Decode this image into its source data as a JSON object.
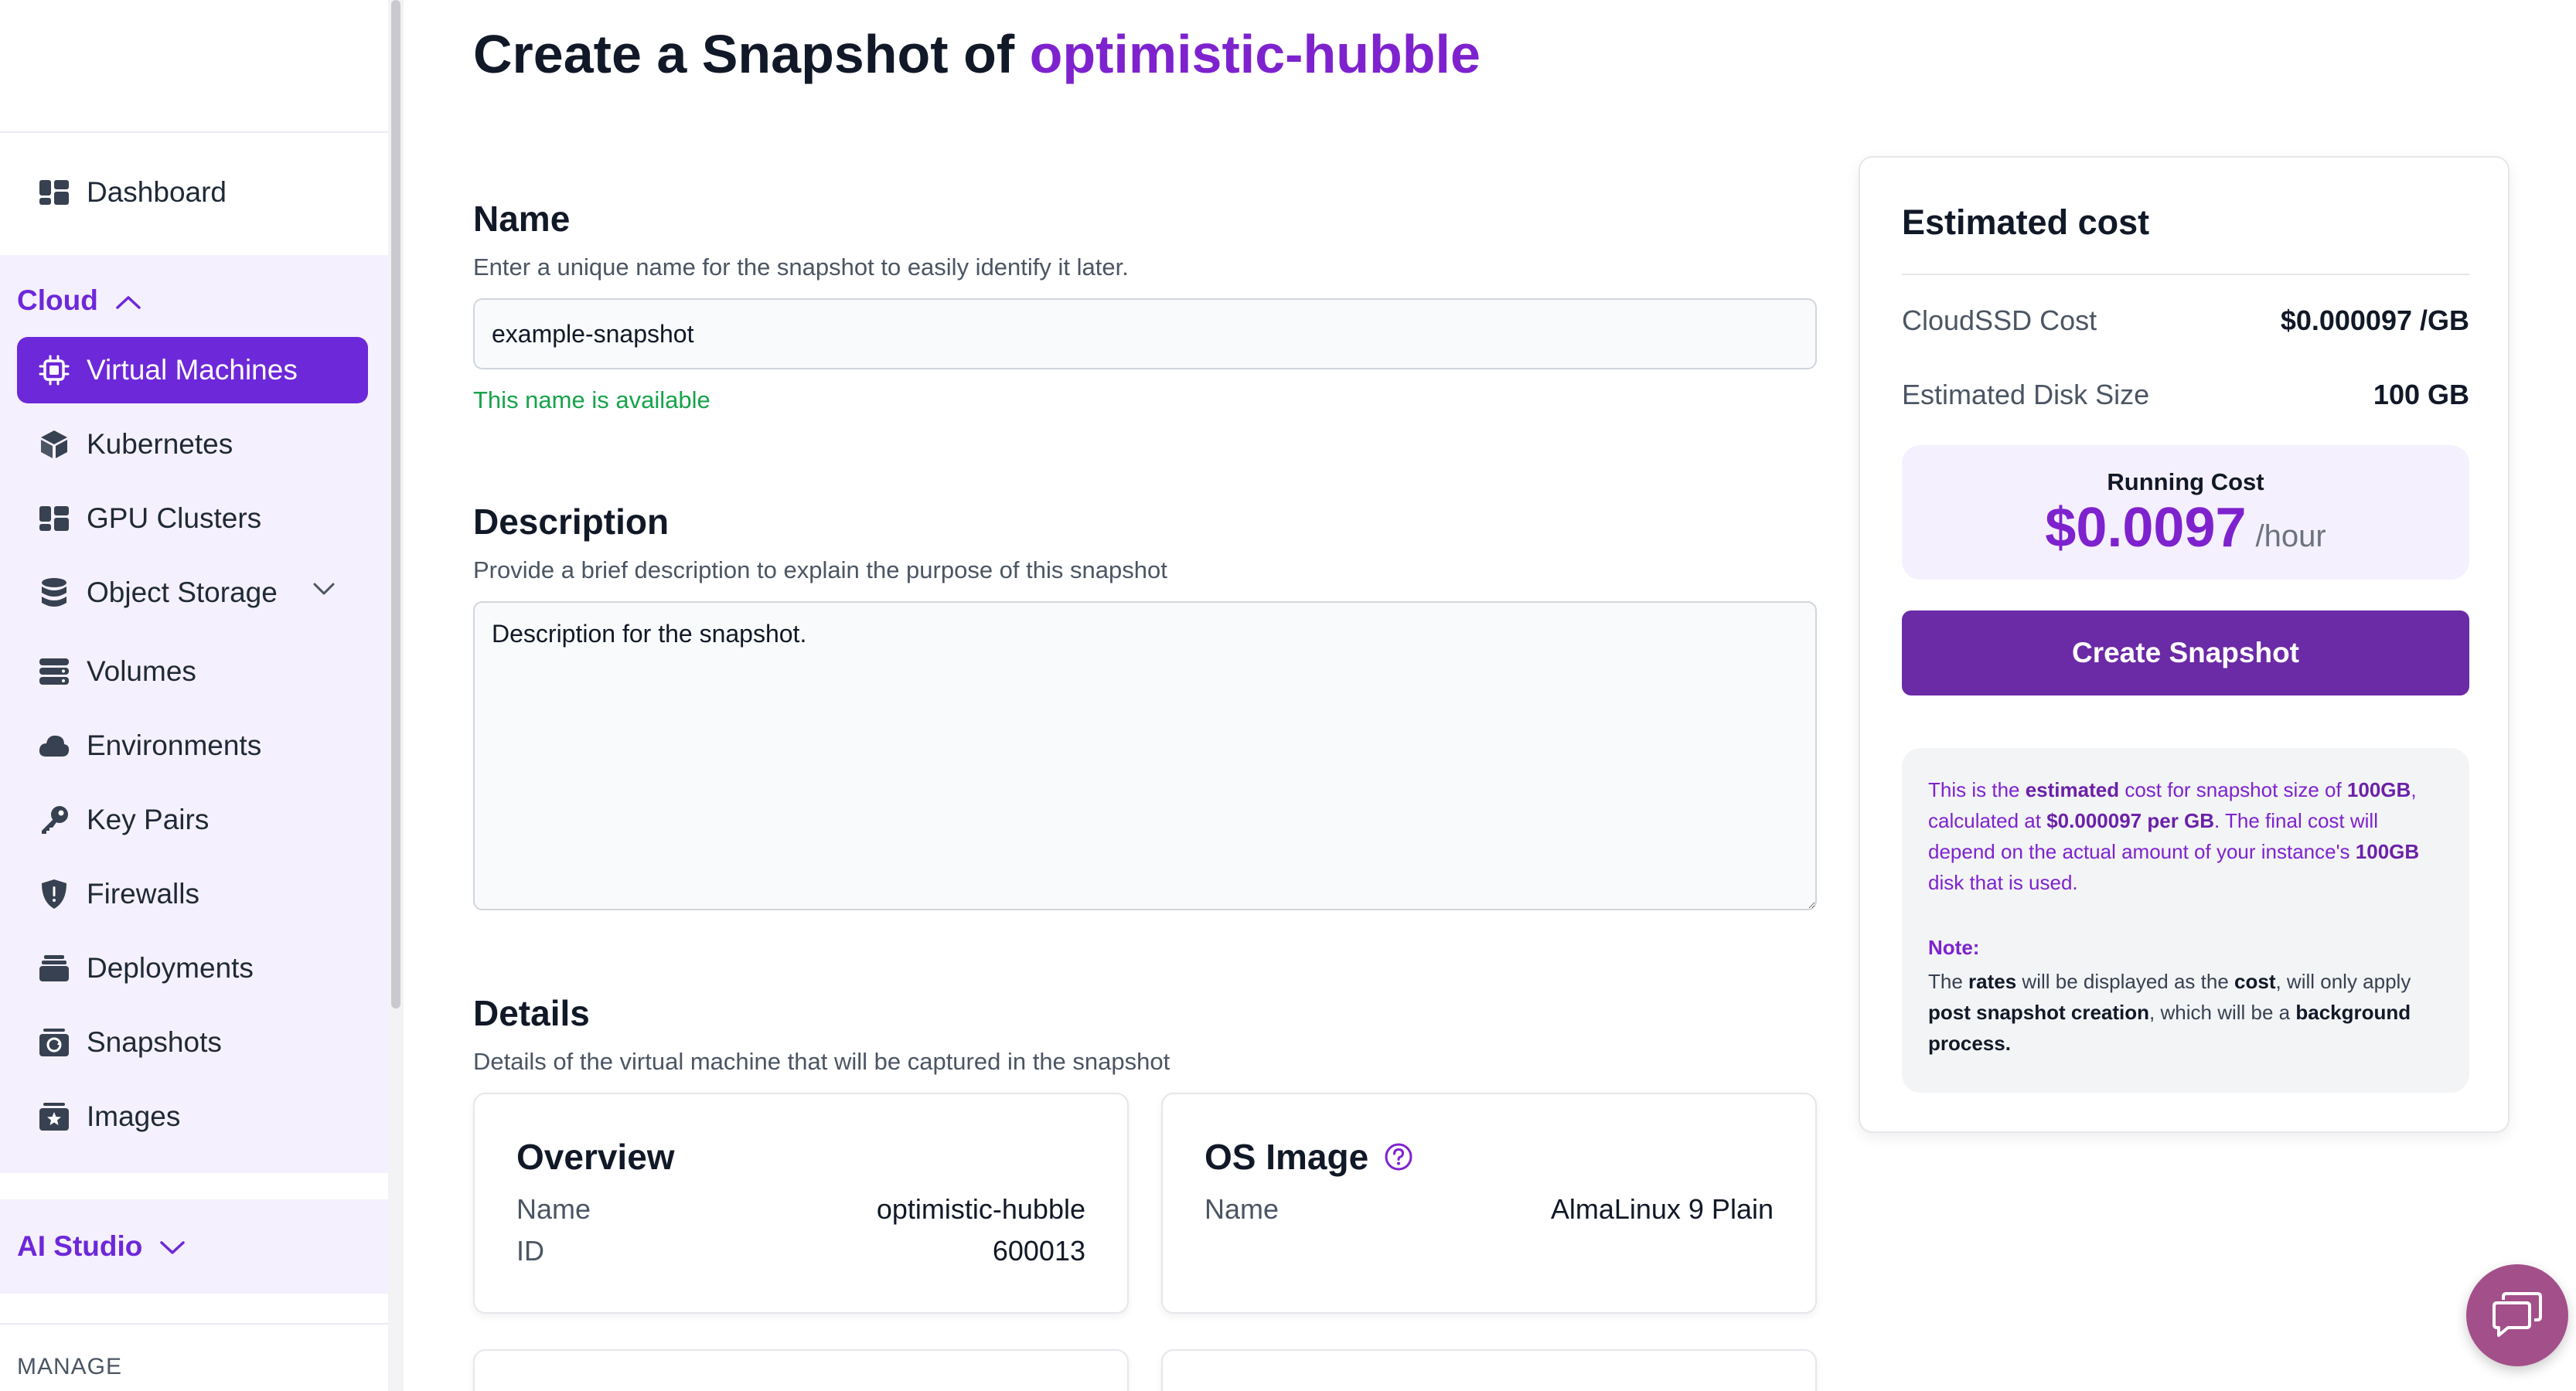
{
  "sidebar": {
    "dashboard": {
      "label": "Dashboard",
      "icon": "dashboard-icon"
    },
    "cloud": {
      "label": "Cloud",
      "items": [
        {
          "label": "Virtual Machines",
          "icon": "cpu-chip-icon",
          "active": true
        },
        {
          "label": "Kubernetes",
          "icon": "cube-icon"
        },
        {
          "label": "GPU Clusters",
          "icon": "grid-icon"
        },
        {
          "label": "Object Storage",
          "icon": "database-icon",
          "has_submenu": true
        },
        {
          "label": "Volumes",
          "icon": "server-stack-icon"
        },
        {
          "label": "Environments",
          "icon": "cloud-icon"
        },
        {
          "label": "Key Pairs",
          "icon": "key-icon"
        },
        {
          "label": "Firewalls",
          "icon": "shield-icon"
        },
        {
          "label": "Deployments",
          "icon": "stack-icon"
        },
        {
          "label": "Snapshots",
          "icon": "camera-icon"
        },
        {
          "label": "Images",
          "icon": "star-image-icon"
        }
      ]
    },
    "ai_studio": {
      "label": "AI Studio"
    },
    "manage_label": "MANAGE"
  },
  "page": {
    "title_prefix": "Create a Snapshot of",
    "title_instance": "optimistic-hubble"
  },
  "form": {
    "name": {
      "title": "Name",
      "subtitle": "Enter a unique name for the snapshot to easily identify it later.",
      "value": "example-snapshot",
      "availability": "This name is available"
    },
    "description": {
      "title": "Description",
      "subtitle": "Provide a brief description to explain the purpose of this snapshot",
      "value": "Description for the snapshot."
    },
    "details": {
      "title": "Details",
      "subtitle": "Details of the virtual machine that will be captured in the snapshot",
      "overview": {
        "title": "Overview",
        "name_label": "Name",
        "name_value": "optimistic-hubble",
        "id_label": "ID",
        "id_value": "600013"
      },
      "os_image": {
        "title": "OS Image",
        "name_label": "Name",
        "name_value": "AlmaLinux 9 Plain"
      }
    }
  },
  "cost": {
    "title": "Estimated cost",
    "cloudssd_label": "CloudSSD Cost",
    "cloudssd_value": "$0.000097 /GB",
    "disk_label": "Estimated Disk Size",
    "disk_value": "100 GB",
    "running_label": "Running Cost",
    "running_amount": "$0.0097",
    "running_unit": "/hour",
    "create_button": "Create Snapshot",
    "info": {
      "t1": "This is the ",
      "b1": "estimated",
      "t2": " cost for snapshot size of ",
      "b2": "100GB",
      "t3": ", calculated at ",
      "b3": "$0.000097 per GB",
      "t4": ". The final cost will depend on the actual amount of your instance's ",
      "b4": "100GB",
      "t5": " disk that is used.",
      "note_label": "Note:",
      "n1": "The ",
      "nb1": "rates",
      "n2": " will be displayed as the ",
      "nb2": "cost",
      "n3": ", will only apply ",
      "nb3": "post snapshot creation",
      "n4": ", which will be a ",
      "nb4": "background process."
    }
  },
  "colors": {
    "accent": "#7e22ce",
    "active_nav": "#6d28d9",
    "button": "#6b2aa6",
    "success": "#16a34a",
    "sidebar_group_bg": "#f5f0fd",
    "chat_bubble": "#a34f8a"
  },
  "chat": {
    "icon": "chat-bubbles-icon"
  }
}
